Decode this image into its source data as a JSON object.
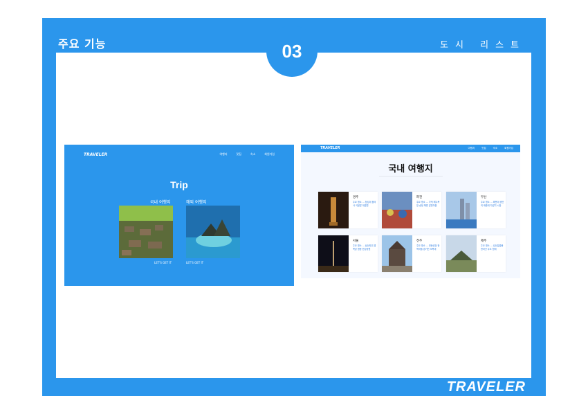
{
  "slide": {
    "section_title": "주요 기능",
    "page_number": "03",
    "subtitle": "도시 리스트",
    "brand": "TRAVELER",
    "accent_color": "#2b96ec"
  },
  "left_screenshot": {
    "logo": "TRAVELER",
    "nav": [
      "여행지",
      "맛집",
      "숙소",
      "회원가입"
    ],
    "title": "Trip",
    "cards": [
      {
        "caption": "국내 여행지",
        "link": "LET'S GET IT"
      },
      {
        "caption": "해외 여행지",
        "link": "LET'S GET IT"
      }
    ]
  },
  "right_screenshot": {
    "logo": "TRAVELER",
    "nav": [
      "여행지",
      "맛집",
      "숙소",
      "회원가입"
    ],
    "title": "국내 여행지",
    "cards": [
      {
        "name": "경주",
        "desc": "주요 명소 ... 첨성대 불국사 석굴암 대릉원"
      },
      {
        "name": "파전",
        "desc": "주요 명소 ... 가덕 해수욕장 송정 해변 감천마을"
      },
      {
        "name": "부산",
        "desc": "주요 명소 ... 해운대 광안리 태종대 자갈치 시장"
      },
      {
        "name": "서울",
        "desc": "주요 명소 ... 남산타워 경복궁 명동 한강공원"
      },
      {
        "name": "전주",
        "desc": "주요 명소 ... 전동성당 한옥마을 경기전 오목대"
      },
      {
        "name": "제주",
        "desc": "주요 명소 ... 성산일출봉 한라산 우도 협재"
      }
    ]
  }
}
